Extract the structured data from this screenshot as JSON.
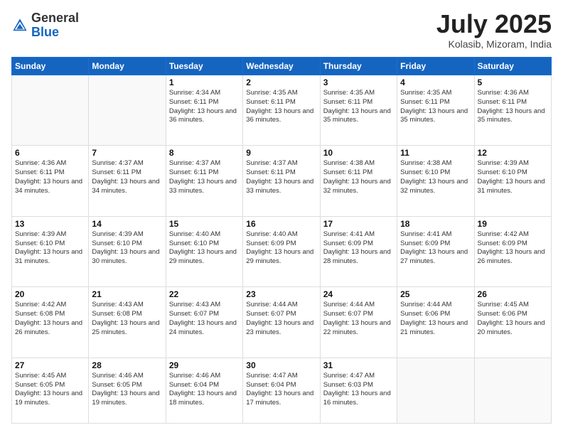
{
  "header": {
    "logo_general": "General",
    "logo_blue": "Blue",
    "month_year": "July 2025",
    "location": "Kolasib, Mizoram, India"
  },
  "days_of_week": [
    "Sunday",
    "Monday",
    "Tuesday",
    "Wednesday",
    "Thursday",
    "Friday",
    "Saturday"
  ],
  "weeks": [
    [
      {
        "day": "",
        "sunrise": "",
        "sunset": "",
        "daylight": ""
      },
      {
        "day": "",
        "sunrise": "",
        "sunset": "",
        "daylight": ""
      },
      {
        "day": "1",
        "sunrise": "Sunrise: 4:34 AM",
        "sunset": "Sunset: 6:11 PM",
        "daylight": "Daylight: 13 hours and 36 minutes."
      },
      {
        "day": "2",
        "sunrise": "Sunrise: 4:35 AM",
        "sunset": "Sunset: 6:11 PM",
        "daylight": "Daylight: 13 hours and 36 minutes."
      },
      {
        "day": "3",
        "sunrise": "Sunrise: 4:35 AM",
        "sunset": "Sunset: 6:11 PM",
        "daylight": "Daylight: 13 hours and 35 minutes."
      },
      {
        "day": "4",
        "sunrise": "Sunrise: 4:35 AM",
        "sunset": "Sunset: 6:11 PM",
        "daylight": "Daylight: 13 hours and 35 minutes."
      },
      {
        "day": "5",
        "sunrise": "Sunrise: 4:36 AM",
        "sunset": "Sunset: 6:11 PM",
        "daylight": "Daylight: 13 hours and 35 minutes."
      }
    ],
    [
      {
        "day": "6",
        "sunrise": "Sunrise: 4:36 AM",
        "sunset": "Sunset: 6:11 PM",
        "daylight": "Daylight: 13 hours and 34 minutes."
      },
      {
        "day": "7",
        "sunrise": "Sunrise: 4:37 AM",
        "sunset": "Sunset: 6:11 PM",
        "daylight": "Daylight: 13 hours and 34 minutes."
      },
      {
        "day": "8",
        "sunrise": "Sunrise: 4:37 AM",
        "sunset": "Sunset: 6:11 PM",
        "daylight": "Daylight: 13 hours and 33 minutes."
      },
      {
        "day": "9",
        "sunrise": "Sunrise: 4:37 AM",
        "sunset": "Sunset: 6:11 PM",
        "daylight": "Daylight: 13 hours and 33 minutes."
      },
      {
        "day": "10",
        "sunrise": "Sunrise: 4:38 AM",
        "sunset": "Sunset: 6:11 PM",
        "daylight": "Daylight: 13 hours and 32 minutes."
      },
      {
        "day": "11",
        "sunrise": "Sunrise: 4:38 AM",
        "sunset": "Sunset: 6:10 PM",
        "daylight": "Daylight: 13 hours and 32 minutes."
      },
      {
        "day": "12",
        "sunrise": "Sunrise: 4:39 AM",
        "sunset": "Sunset: 6:10 PM",
        "daylight": "Daylight: 13 hours and 31 minutes."
      }
    ],
    [
      {
        "day": "13",
        "sunrise": "Sunrise: 4:39 AM",
        "sunset": "Sunset: 6:10 PM",
        "daylight": "Daylight: 13 hours and 31 minutes."
      },
      {
        "day": "14",
        "sunrise": "Sunrise: 4:39 AM",
        "sunset": "Sunset: 6:10 PM",
        "daylight": "Daylight: 13 hours and 30 minutes."
      },
      {
        "day": "15",
        "sunrise": "Sunrise: 4:40 AM",
        "sunset": "Sunset: 6:10 PM",
        "daylight": "Daylight: 13 hours and 29 minutes."
      },
      {
        "day": "16",
        "sunrise": "Sunrise: 4:40 AM",
        "sunset": "Sunset: 6:09 PM",
        "daylight": "Daylight: 13 hours and 29 minutes."
      },
      {
        "day": "17",
        "sunrise": "Sunrise: 4:41 AM",
        "sunset": "Sunset: 6:09 PM",
        "daylight": "Daylight: 13 hours and 28 minutes."
      },
      {
        "day": "18",
        "sunrise": "Sunrise: 4:41 AM",
        "sunset": "Sunset: 6:09 PM",
        "daylight": "Daylight: 13 hours and 27 minutes."
      },
      {
        "day": "19",
        "sunrise": "Sunrise: 4:42 AM",
        "sunset": "Sunset: 6:09 PM",
        "daylight": "Daylight: 13 hours and 26 minutes."
      }
    ],
    [
      {
        "day": "20",
        "sunrise": "Sunrise: 4:42 AM",
        "sunset": "Sunset: 6:08 PM",
        "daylight": "Daylight: 13 hours and 26 minutes."
      },
      {
        "day": "21",
        "sunrise": "Sunrise: 4:43 AM",
        "sunset": "Sunset: 6:08 PM",
        "daylight": "Daylight: 13 hours and 25 minutes."
      },
      {
        "day": "22",
        "sunrise": "Sunrise: 4:43 AM",
        "sunset": "Sunset: 6:07 PM",
        "daylight": "Daylight: 13 hours and 24 minutes."
      },
      {
        "day": "23",
        "sunrise": "Sunrise: 4:44 AM",
        "sunset": "Sunset: 6:07 PM",
        "daylight": "Daylight: 13 hours and 23 minutes."
      },
      {
        "day": "24",
        "sunrise": "Sunrise: 4:44 AM",
        "sunset": "Sunset: 6:07 PM",
        "daylight": "Daylight: 13 hours and 22 minutes."
      },
      {
        "day": "25",
        "sunrise": "Sunrise: 4:44 AM",
        "sunset": "Sunset: 6:06 PM",
        "daylight": "Daylight: 13 hours and 21 minutes."
      },
      {
        "day": "26",
        "sunrise": "Sunrise: 4:45 AM",
        "sunset": "Sunset: 6:06 PM",
        "daylight": "Daylight: 13 hours and 20 minutes."
      }
    ],
    [
      {
        "day": "27",
        "sunrise": "Sunrise: 4:45 AM",
        "sunset": "Sunset: 6:05 PM",
        "daylight": "Daylight: 13 hours and 19 minutes."
      },
      {
        "day": "28",
        "sunrise": "Sunrise: 4:46 AM",
        "sunset": "Sunset: 6:05 PM",
        "daylight": "Daylight: 13 hours and 19 minutes."
      },
      {
        "day": "29",
        "sunrise": "Sunrise: 4:46 AM",
        "sunset": "Sunset: 6:04 PM",
        "daylight": "Daylight: 13 hours and 18 minutes."
      },
      {
        "day": "30",
        "sunrise": "Sunrise: 4:47 AM",
        "sunset": "Sunset: 6:04 PM",
        "daylight": "Daylight: 13 hours and 17 minutes."
      },
      {
        "day": "31",
        "sunrise": "Sunrise: 4:47 AM",
        "sunset": "Sunset: 6:03 PM",
        "daylight": "Daylight: 13 hours and 16 minutes."
      },
      {
        "day": "",
        "sunrise": "",
        "sunset": "",
        "daylight": ""
      },
      {
        "day": "",
        "sunrise": "",
        "sunset": "",
        "daylight": ""
      }
    ]
  ]
}
